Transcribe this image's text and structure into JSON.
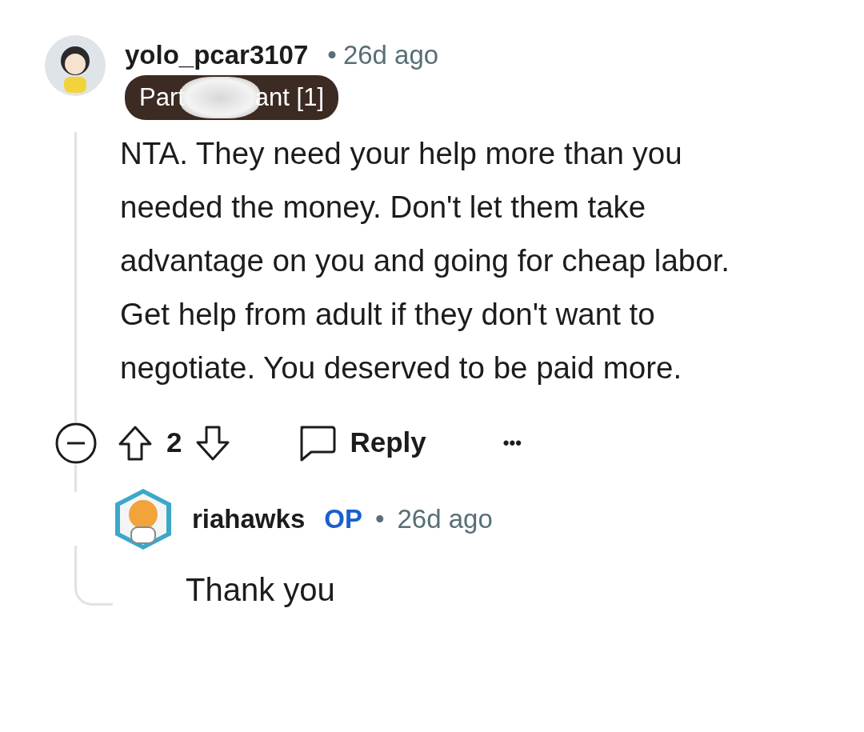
{
  "comment": {
    "author": "yolo_pcar3107",
    "separator": "•",
    "time": "26d ago",
    "flair_parts": [
      "Part",
      "ant [1]"
    ],
    "body": "NTA. They need your help more than you needed the money. Don't let them take advantage on you and going for cheap labor. Get help from adult if they don't want to negotiate. You deserved to be paid more.",
    "score": "2",
    "reply_label": "Reply",
    "more": "•••",
    "collapsed": false
  },
  "reply": {
    "author": "riahawks",
    "badge": "OP",
    "separator": "•",
    "time": "26d ago",
    "body": "Thank you"
  }
}
